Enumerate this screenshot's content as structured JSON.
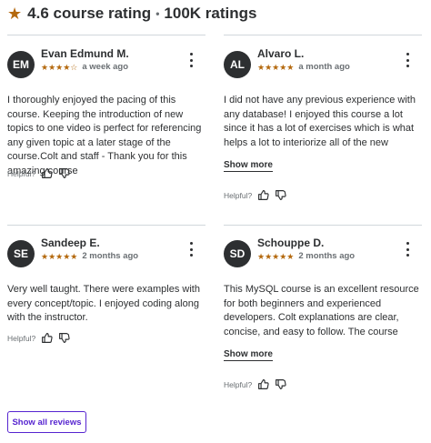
{
  "header": {
    "star_icon": "star-icon",
    "rating": "4.6 course rating",
    "separator": "•",
    "ratings_count": "100K ratings"
  },
  "reviews": [
    {
      "initials": "EM",
      "name": "Evan Edmund M.",
      "stars": "★★★★☆",
      "rating_value": 4.5,
      "date": "a week ago",
      "text": "I thoroughly enjoyed the pacing of this course. Keeping the introduction of new topics to one video is perfect for referencing any given topic at a later stage of the course.Colt and staff - Thank you for this amazing course",
      "show_more": "",
      "helpful": "Helpful?"
    },
    {
      "initials": "AL",
      "name": "Alvaro L.",
      "stars": "★★★★★",
      "rating_value": 5,
      "date": "a month ago",
      "text": "I did not have any previous experience with any database! I enjoyed this course a lot since it has a lot of exercises which is what helps a lot to interiorize all of the new concepts and syntax. Of course I gotta keep on practicing,...",
      "show_more": "Show more",
      "helpful": "Helpful?"
    },
    {
      "initials": "SE",
      "name": "Sandeep E.",
      "stars": "★★★★★",
      "rating_value": 5,
      "date": "2 months ago",
      "text": "Very well taught. There were examples with every concept/topic. I enjoyed coding along with the instructor.",
      "show_more": "",
      "helpful": "Helpful?"
    },
    {
      "initials": "SD",
      "name": "Schouppe D.",
      "stars": "★★★★★",
      "rating_value": 5,
      "date": "2 months ago",
      "text": "This MySQL course is an excellent resource for both beginners and experienced developers. Colt explanations are clear, concise, and easy to follow. The course covers a wide range of topics, from basic SQL syntax to advanced...",
      "show_more": "Show more",
      "helpful": "Helpful?"
    }
  ],
  "footer": {
    "show_all": "Show all reviews"
  },
  "colors": {
    "star": "#b4690e",
    "accent": "#5624d0",
    "text": "#2d2f31",
    "muted": "#6a6f73",
    "divider": "#d1d7dc"
  }
}
